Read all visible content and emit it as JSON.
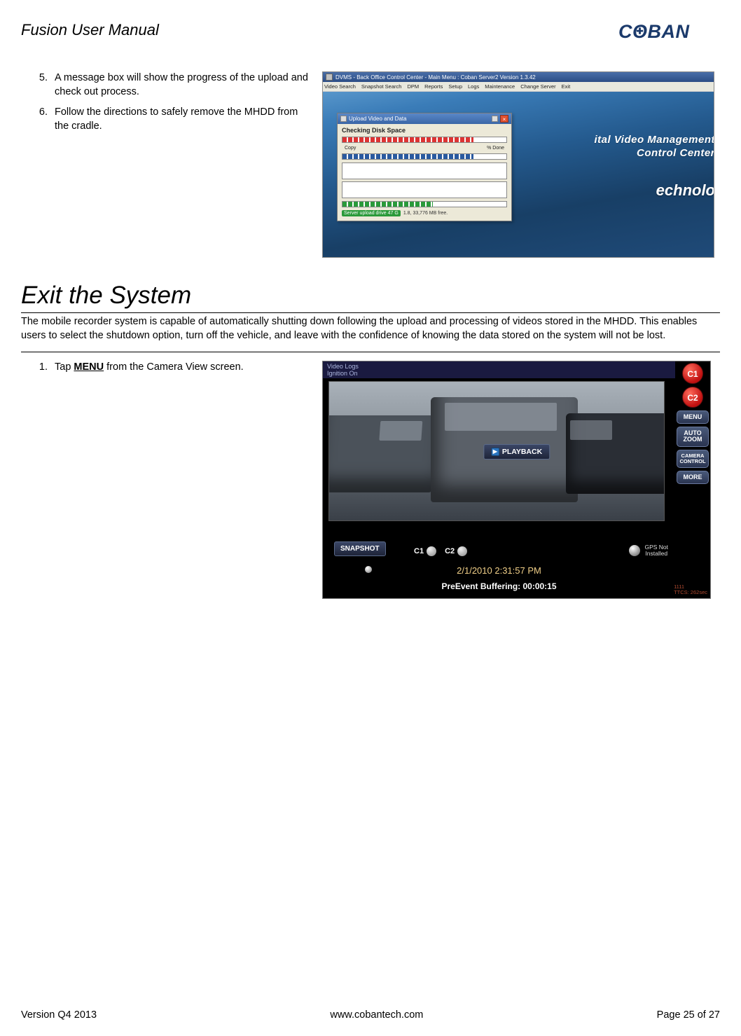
{
  "header": {
    "doc_title": "Fusion User Manual",
    "logo_text_pre": "C",
    "logo_text_o": "O",
    "logo_text_post": "BAN"
  },
  "steps_upper": {
    "s5": "A message box will show the progress of the upload and check out process.",
    "s6": "Follow the directions to safely remove the MHDD from the cradle."
  },
  "app_window": {
    "title": "DVMS - Back Office Control Center - Main Menu : Coban Server2 Version 1.3.42",
    "menus": [
      "Video Search",
      "Snapshot Search",
      "DPM",
      "Reports",
      "Setup",
      "Logs",
      "Maintenance",
      "Change Server",
      "Exit"
    ],
    "brand_line1": "ital Video Management",
    "brand_line2": "Control Center",
    "brand_line3": "echnolo",
    "dialog": {
      "title": "Upload Video and Data",
      "heading": "Checking Disk Space",
      "labels": {
        "copy": "Copy",
        "done": "% Done"
      },
      "status_pill": "Server upload drive 47 G",
      "status_rest": "1.8, 33,776 MB free."
    }
  },
  "section_title": "Exit the System",
  "intro": "The mobile recorder system is capable of automatically shutting down following the upload and processing of videos stored in the MHDD. This enables users to select the shutdown option, turn off the vehicle, and leave with the confidence of knowing the data stored on the system will not be lost.",
  "steps_lower": {
    "s1_pre": "Tap ",
    "s1_bold": "MENU",
    "s1_post": " from the Camera View screen."
  },
  "camera_view": {
    "top_line1": "Video Logs",
    "top_line2": "Ignition On",
    "btn_c1": "C1",
    "btn_c2": "C2",
    "btn_menu": "MENU",
    "btn_autozoom_l1": "AUTO",
    "btn_autozoom_l2": "ZOOM",
    "btn_camcontrol_l1": "CAMERA",
    "btn_camcontrol_l2": "CONTROL",
    "btn_more": "MORE",
    "btn_playback": "PLAYBACK",
    "btn_snapshot": "SNAPSHOT",
    "ind_c1": "C1",
    "ind_c2": "C2",
    "gps_l1": "GPS Not",
    "gps_l2": "Installed",
    "timestamp": "2/1/2010 2:31:57 PM",
    "preevent": "PreEvent Buffering: 00:00:15",
    "corner_l1": "1111",
    "corner_l2": "TTCS: 262sec"
  },
  "footer": {
    "version": "Version Q4 2013",
    "url": "www.cobantech.com",
    "page": "Page 25 of 27"
  }
}
